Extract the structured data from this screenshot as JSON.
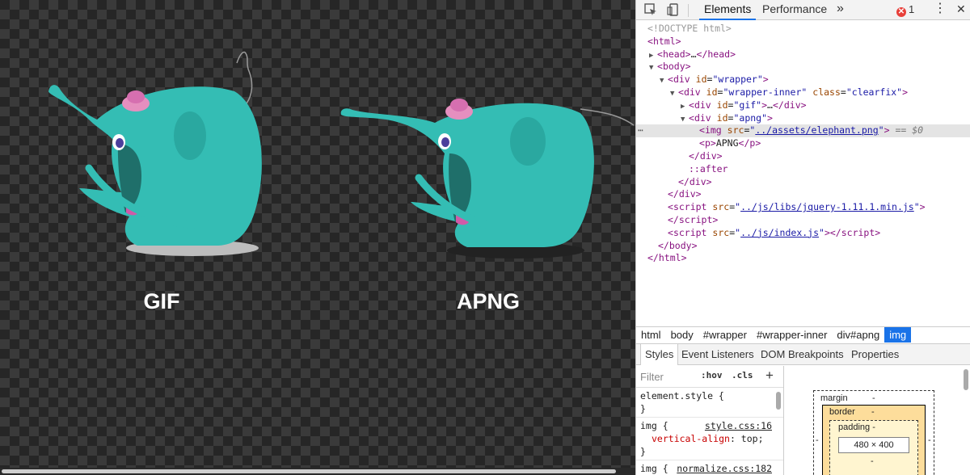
{
  "viewport": {
    "captions": [
      "GIF",
      "APNG"
    ]
  },
  "devtools": {
    "toolbar": {
      "tabs": [
        "Elements",
        "Performance"
      ],
      "more": "»",
      "error_count": "1",
      "menu": "⋮",
      "close": "✕"
    },
    "dom": {
      "doctype": "<!DOCTYPE html>",
      "html_tag": "html",
      "head_tag": "head",
      "head_collapsed": "…",
      "body_tag": "body",
      "wrapper": {
        "tag": "div",
        "attr": "id",
        "value": "wrapper"
      },
      "wrapper_inner": {
        "tag": "div",
        "attr1": "id",
        "value1": "wrapper-inner",
        "attr2": "class",
        "value2": "clearfix"
      },
      "gif_div": {
        "tag": "div",
        "attr": "id",
        "value": "gif",
        "collapsed": "…"
      },
      "apng_div": {
        "tag": "div",
        "attr": "id",
        "value": "apng"
      },
      "img": {
        "tag": "img",
        "attr": "src",
        "value": "../assets/elephant.png",
        "marker": "== $0"
      },
      "p": {
        "tag": "p",
        "text": "APNG"
      },
      "after": "::after",
      "script1": {
        "tag": "script",
        "attr": "src",
        "value": "../js/libs/jquery-1.11.1.min.js"
      },
      "script2": {
        "tag": "script",
        "attr": "src",
        "value": "../js/index.js"
      }
    },
    "breadcrumbs": [
      "html",
      "body",
      "#wrapper",
      "#wrapper-inner",
      "div#apng",
      "img"
    ],
    "sub_tabs": [
      "Styles",
      "Event Listeners",
      "DOM Breakpoints",
      "Properties"
    ],
    "styles": {
      "filter_placeholder": "Filter",
      "hov": ":hov",
      "cls": ".cls",
      "add": "+",
      "element_style": "element.style {",
      "close_brace": "}",
      "rule1": {
        "selector": "img {",
        "source": "style.css:16",
        "property": "vertical-align",
        "value": "top;"
      },
      "rule2": {
        "selector": "img {",
        "source": "normalize.css:182"
      }
    },
    "box_model": {
      "margin_label": "margin",
      "margin_value": "-",
      "border_label": "border",
      "border_value": "-",
      "padding_label": "padding -",
      "content": "480 × 400",
      "side": "-"
    }
  }
}
